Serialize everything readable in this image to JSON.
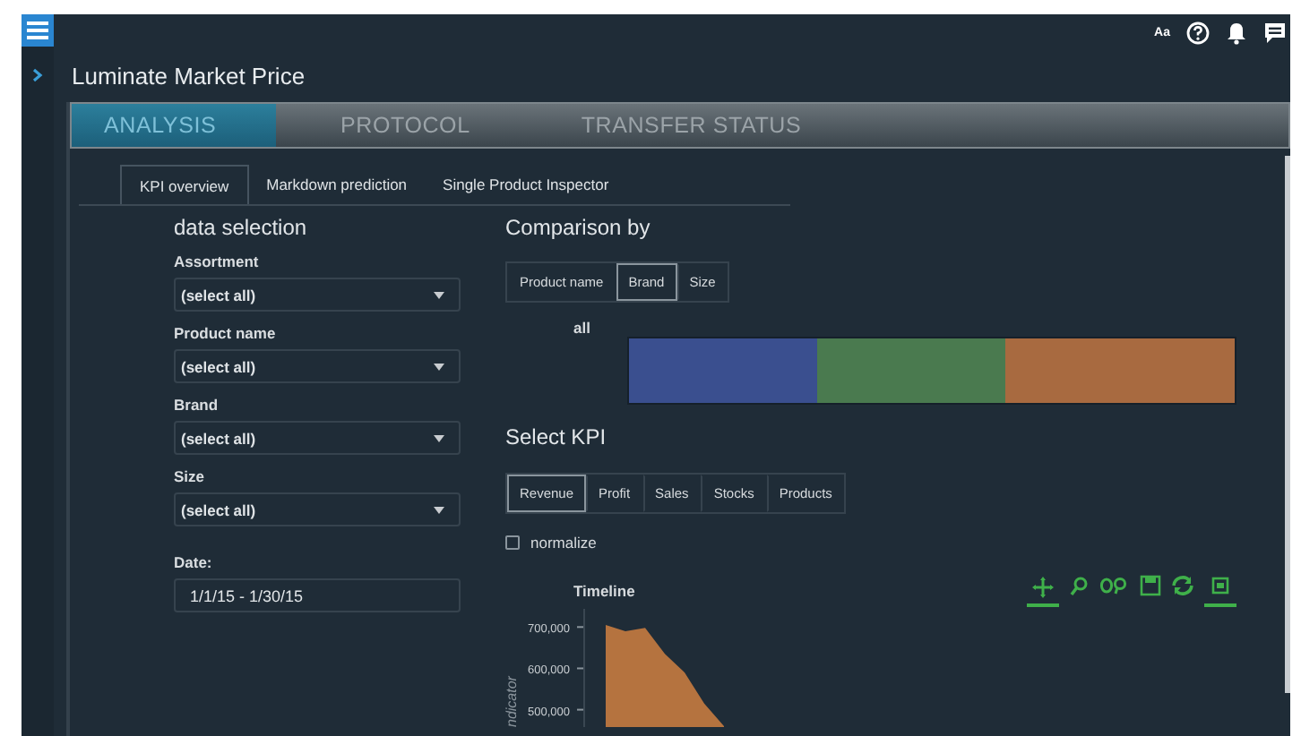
{
  "header": {
    "title": "Luminate Market Price",
    "icons": [
      {
        "kind": "font",
        "label": "Aa"
      },
      {
        "kind": "help"
      },
      {
        "kind": "bell"
      },
      {
        "kind": "chat"
      }
    ]
  },
  "tabs": [
    {
      "label": "ANALYSIS",
      "selected": true
    },
    {
      "label": "PROTOCOL",
      "selected": false
    },
    {
      "label": "TRANSFER STATUS",
      "selected": false
    }
  ],
  "subtabs": [
    {
      "label": "KPI overview",
      "selected": true
    },
    {
      "label": "Markdown prediction",
      "selected": false
    },
    {
      "label": "Single Product Inspector",
      "selected": false
    }
  ],
  "data_selection": {
    "heading": "data selection",
    "filters": [
      {
        "label": "Assortment",
        "value": "(select all)"
      },
      {
        "label": "Product name",
        "value": "(select all)"
      },
      {
        "label": "Brand",
        "value": "(select all)"
      },
      {
        "label": "Size",
        "value": "(select all)"
      }
    ],
    "date": {
      "label": "Date:",
      "value": "1/1/15 - 1/30/15"
    }
  },
  "comparison": {
    "heading": "Comparison by",
    "options": [
      {
        "label": "Product name",
        "selected": false
      },
      {
        "label": "Brand",
        "selected": true
      },
      {
        "label": "Size",
        "selected": false
      }
    ],
    "row_label": "all",
    "segments": [
      {
        "color": "#3a4f8f"
      },
      {
        "color": "#4a7a4f"
      },
      {
        "color": "#a86a40"
      }
    ]
  },
  "kpi": {
    "heading": "Select KPI",
    "options": [
      {
        "label": "Revenue",
        "selected": true
      },
      {
        "label": "Profit",
        "selected": false
      },
      {
        "label": "Sales",
        "selected": false
      },
      {
        "label": "Stocks",
        "selected": false
      },
      {
        "label": "Products",
        "selected": false
      }
    ],
    "normalize": {
      "label": "normalize",
      "checked": false
    }
  },
  "timeline": {
    "toolbar": [
      {
        "kind": "pan",
        "selected": true
      },
      {
        "kind": "zoom",
        "selected": false
      },
      {
        "kind": "zoom-out",
        "selected": false
      },
      {
        "kind": "save",
        "selected": false
      },
      {
        "kind": "reset",
        "selected": false
      },
      {
        "kind": "box",
        "selected": true
      }
    ],
    "chart_data": {
      "type": "area",
      "title": "Timeline",
      "ylabel": "ndicator",
      "ylim": [
        458000,
        744000
      ],
      "yticks": [
        {
          "value": 500000,
          "label": "500,000"
        },
        {
          "value": 600000,
          "label": "600,000"
        },
        {
          "value": 700000,
          "label": "700,000"
        }
      ],
      "series": [
        {
          "color": "#b5733f",
          "values": [
            705000,
            690000,
            698000,
            635000,
            590000,
            515000,
            460000
          ]
        }
      ]
    }
  }
}
